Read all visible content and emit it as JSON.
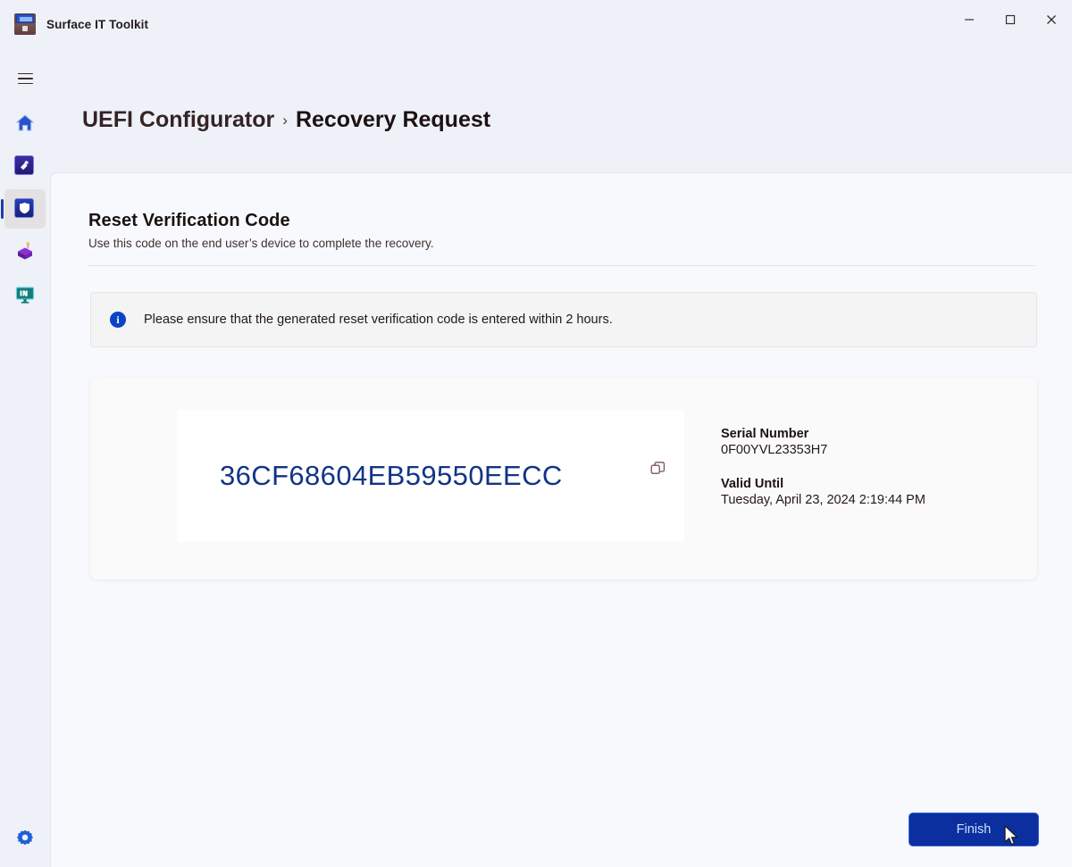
{
  "window": {
    "app_title": "Surface IT Toolkit",
    "app_icon": "toolkit-briefcase-icon",
    "controls": {
      "minimize": "minimize-icon",
      "maximize": "maximize-icon",
      "close": "close-icon"
    }
  },
  "sidebar": {
    "menu_icon": "hamburger-menu-icon",
    "items": [
      {
        "icon": "home-icon",
        "name": "home",
        "selected": false
      },
      {
        "icon": "data-eraser-icon",
        "name": "data-eraser",
        "selected": false
      },
      {
        "icon": "shield-uefi-configurator-icon",
        "name": "uefi-configurator",
        "selected": true
      },
      {
        "icon": "package-builder-icon",
        "name": "package-builder",
        "selected": false
      },
      {
        "icon": "monitor-diagnostics-icon",
        "name": "diagnostics",
        "selected": false
      }
    ],
    "settings_icon": "gear-icon"
  },
  "breadcrumb": {
    "parent": "UEFI Configurator",
    "separator": "›",
    "current": "Recovery Request"
  },
  "main": {
    "title": "Reset Verification Code",
    "subtitle": "Use this code on the end user’s device to complete the recovery.",
    "info": {
      "icon": "info-circle-icon",
      "glyph": "i",
      "text": "Please ensure that the generated reset verification code is entered within 2 hours."
    },
    "code_card": {
      "code": "36CF68604EB59550EECC",
      "copy_icon": "copy-icon",
      "details": [
        {
          "label": "Serial Number",
          "value": "0F00YVL23353H7"
        },
        {
          "label": "Valid Until",
          "value": "Tuesday, April 23, 2024 2:19:44 PM"
        }
      ]
    },
    "finish_label": "Finish"
  },
  "colors": {
    "accent": "#0b2f9e",
    "code_text": "#123486",
    "info_icon": "#0a43c8",
    "selection_bar": "#1b3ea8",
    "page_bg": "#eef1f8",
    "panel_bg": "#f7f9fc"
  }
}
